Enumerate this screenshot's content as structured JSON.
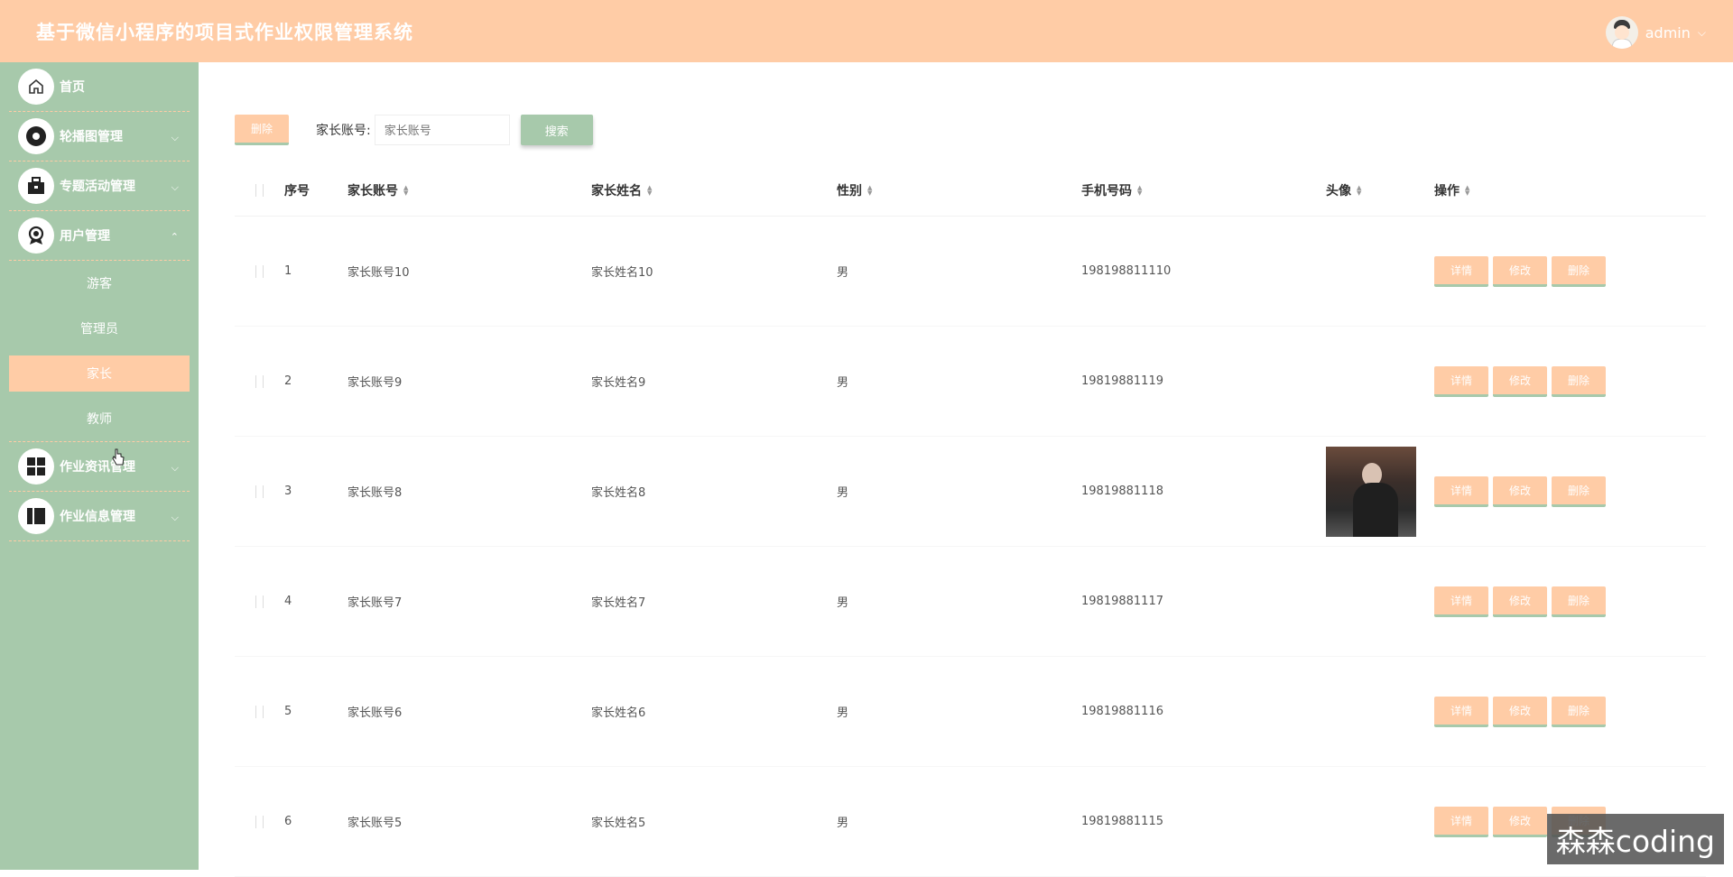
{
  "header": {
    "title": "基于微信小程序的项目式作业权限管理系统",
    "username": "admin"
  },
  "sidebar": {
    "items": [
      {
        "label": "首页",
        "icon": "home-icon"
      },
      {
        "label": "轮播图管理",
        "icon": "carousel-icon"
      },
      {
        "label": "专题活动管理",
        "icon": "briefcase-icon"
      },
      {
        "label": "用户管理",
        "icon": "user-badge-icon"
      },
      {
        "label": "作业资讯管理",
        "icon": "grid-icon"
      },
      {
        "label": "作业信息管理",
        "icon": "book-icon"
      }
    ],
    "submenu": [
      {
        "label": "游客"
      },
      {
        "label": "管理员"
      },
      {
        "label": "家长",
        "active": true
      },
      {
        "label": "教师"
      }
    ]
  },
  "toolbar": {
    "delete_label": "删除",
    "search_label": "家长账号:",
    "search_placeholder": "家长账号",
    "search_button": "搜索"
  },
  "table": {
    "headers": [
      "序号",
      "家长账号",
      "家长姓名",
      "性别",
      "手机号码",
      "头像",
      "操作"
    ],
    "rows": [
      {
        "idx": "1",
        "account": "家长账号10",
        "name": "家长姓名10",
        "sex": "男",
        "phone": "198198811110"
      },
      {
        "idx": "2",
        "account": "家长账号9",
        "name": "家长姓名9",
        "sex": "男",
        "phone": "19819881119"
      },
      {
        "idx": "3",
        "account": "家长账号8",
        "name": "家长姓名8",
        "sex": "男",
        "phone": "19819881118"
      },
      {
        "idx": "4",
        "account": "家长账号7",
        "name": "家长姓名7",
        "sex": "男",
        "phone": "19819881117"
      },
      {
        "idx": "5",
        "account": "家长账号6",
        "name": "家长姓名6",
        "sex": "男",
        "phone": "19819881116"
      },
      {
        "idx": "6",
        "account": "家长账号5",
        "name": "家长姓名5",
        "sex": "男",
        "phone": "19819881115"
      }
    ],
    "ops": {
      "detail": "详情",
      "edit": "修改",
      "delete": "删除"
    }
  },
  "watermark": "森森coding",
  "colors": {
    "accent": "#ffcca6",
    "sidebar": "#a7c9ab"
  }
}
